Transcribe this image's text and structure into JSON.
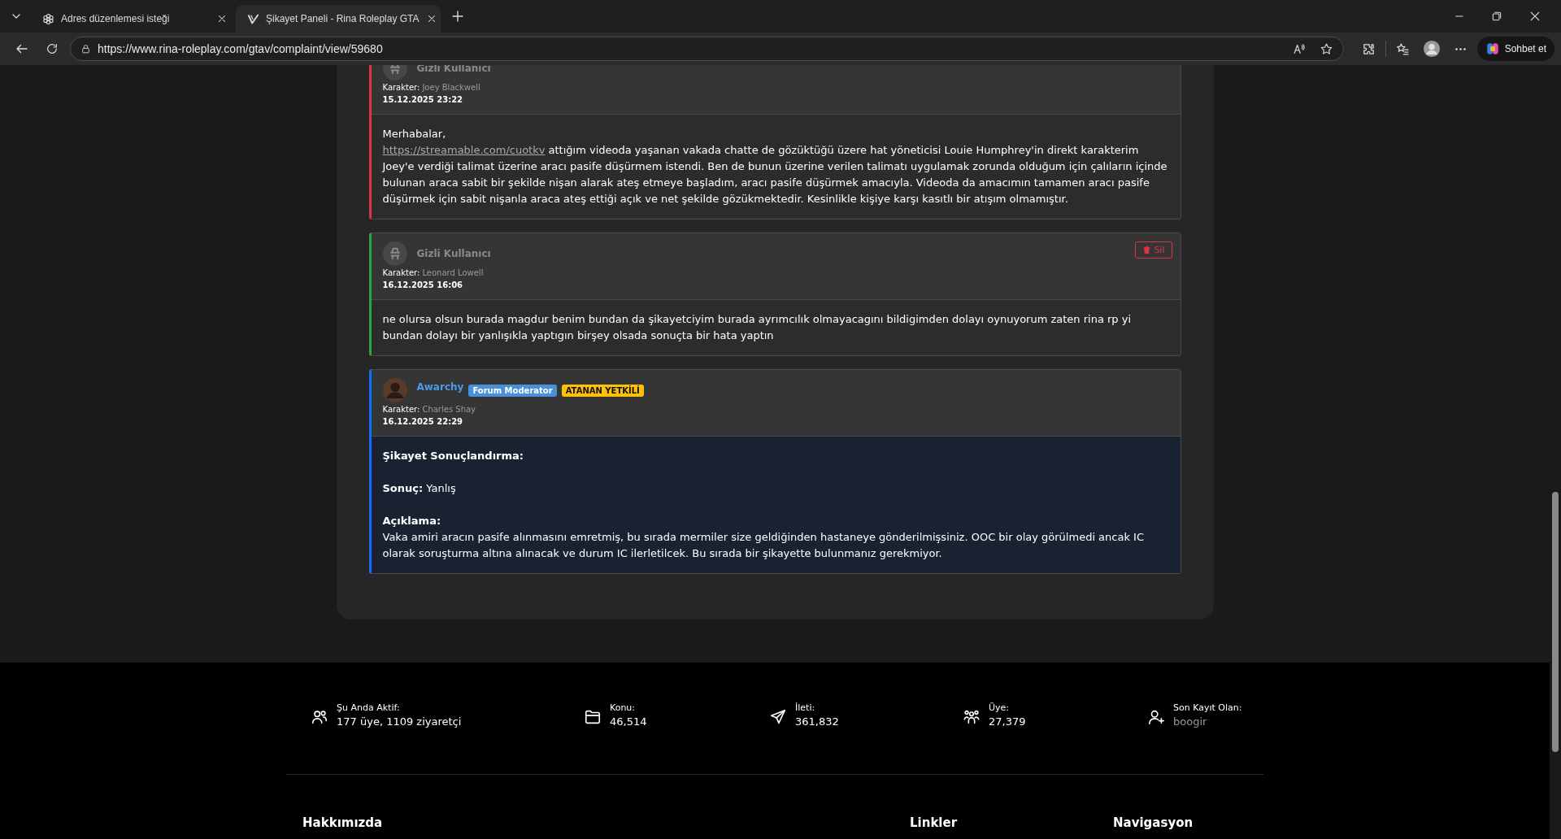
{
  "browser": {
    "tabs": [
      {
        "title": "Adres düzenlemesi isteği",
        "selected": false
      },
      {
        "title": "Şikayet Paneli - Rina Roleplay GTA",
        "selected": true
      }
    ],
    "url": "https://www.rina-roleplay.com/gtav/complaint/view/59680",
    "chat_button": "Sohbet et"
  },
  "comments": [
    {
      "kind": "anonymous",
      "author": "Gizli Kullanıcı",
      "character_label": "Karakter:",
      "character": "Joey Blackwell",
      "date": "15.12.2025 23:22",
      "color": "#dc3545",
      "blocks": [
        [
          {
            "kind": "text",
            "text": "Merhabalar,"
          },
          {
            "kind": "text",
            "link": "https://streamable.com/cuotkv",
            "text": " attığım videoda yaşanan vakada chatte de gözüktüğü üzere hat yöneticisi Louie Humphrey'in direkt karakterim Joey'e verdiği talimat üzerine aracı pasife düşürmem istendi. Ben de bunun üzerine verilen talimatı uygulamak zorunda olduğum için çalıların içinde bulunan araca sabit bir şekilde nişan alarak ateş etmeye başladım, aracı pasife düşürmek amacıyla. Videoda da amacımın tamamen aracı pasife düşürmek için sabit nişanla araca ateş ettiği açık ve net şekilde gözükmektedir. Kesinlikle kişiye karşı kasıtlı bir atışım olmamıştır."
          }
        ]
      ]
    },
    {
      "kind": "anonymous",
      "author": "Gizli Kullanıcı",
      "character_label": "Karakter:",
      "character": "Leonard Lowell",
      "date": "16.12.2025 16:06",
      "color": "#28a745",
      "delete_button": "Sil",
      "blocks": [
        [
          {
            "kind": "text",
            "text": "ne olursa olsun burada magdur benim bundan da şikayetciyim burada ayrımcılık olmayacagını bildigimden dolayı oynuyorum zaten rina rp yi bundan dolayı bir yanlışıkla yaptıgın birşey olsada sonuçta bir hata yaptın"
          }
        ]
      ]
    },
    {
      "kind": "staff",
      "author": "Awarchy",
      "badges": [
        {
          "label": "Forum Moderator",
          "color": "#4a90d9"
        },
        {
          "label": "ATANAN YETKİLİ",
          "color": "#ffc107"
        }
      ],
      "character_label": "Karakter:",
      "character": "Charles Shay",
      "date": "16.12.2025 22:29",
      "color": "#0d6efd",
      "blocks": [
        [
          {
            "kind": "heading",
            "text": "Şikayet Sonuçlandırma:"
          }
        ],
        [
          {
            "kind": "text",
            "text": "**Sonuç:** Yanlış"
          }
        ],
        [
          {
            "kind": "heading",
            "text": "Açıklama:"
          },
          {
            "kind": "text",
            "text": "Vaka amiri aracın pasife alınmasını emretmiş, bu sırada mermiler size geldiğinden hastaneye gönderilmişsiniz. OOC bir olay görülmedi ancak IC olarak soruşturma altına alınacak ve durum IC ilerletilcek. Bu sırada bir şikayette bulunmanız gerekmiyor."
          }
        ]
      ]
    }
  ],
  "footer": {
    "stats": [
      {
        "label": "Şu Anda Aktif:",
        "value": "177 üye, 1109 ziyaretçi",
        "kind": "text"
      },
      {
        "label": "Konu:",
        "value": "46,514",
        "kind": "text"
      },
      {
        "label": "İleti:",
        "value": "361,832",
        "kind": "text"
      },
      {
        "label": "Üye:",
        "value": "27,379",
        "kind": "text"
      },
      {
        "label": "Son Kayıt Olan:",
        "value": "boogir",
        "kind": "link"
      }
    ],
    "headings": [
      "Hakkımızda",
      "Linkler",
      "Navigasyon"
    ]
  }
}
